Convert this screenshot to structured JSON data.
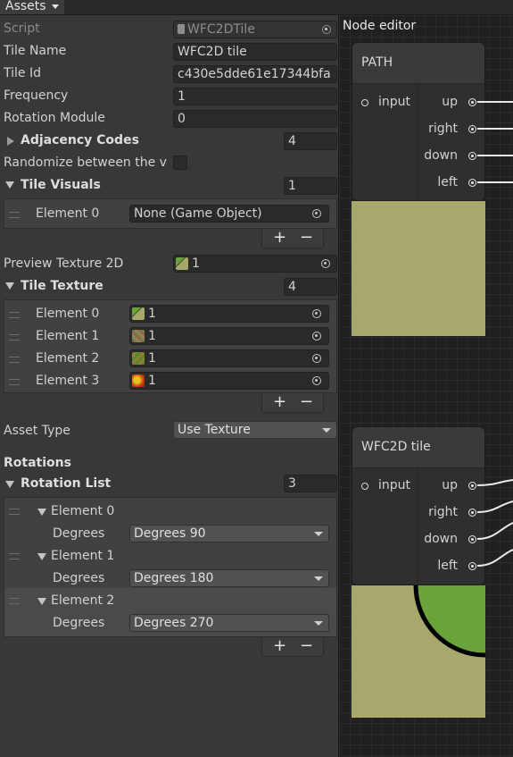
{
  "topbar": {
    "assets_label": "Assets"
  },
  "inspector": {
    "script": {
      "label": "Script",
      "value": "WFC2DTile"
    },
    "tile_name": {
      "label": "Tile Name",
      "value": "WFC2D tile"
    },
    "tile_id": {
      "label": "Tile Id",
      "value": "c430e5dde61e17344bfa"
    },
    "frequency": {
      "label": "Frequency",
      "value": "1"
    },
    "rotation_module": {
      "label": "Rotation Module",
      "value": "0"
    },
    "adjacency_codes": {
      "label": "Adjacency Codes",
      "count": "4"
    },
    "randomize": {
      "label": "Randomize between the v"
    },
    "tile_visuals": {
      "label": "Tile Visuals",
      "count": "1",
      "elements": [
        {
          "label": "Element 0",
          "value": "None (Game Object)"
        }
      ]
    },
    "preview_texture": {
      "label": "Preview Texture 2D",
      "value": "1"
    },
    "tile_texture": {
      "label": "Tile Texture",
      "count": "4",
      "elements": [
        {
          "label": "Element 0",
          "value": "1"
        },
        {
          "label": "Element 1",
          "value": "1"
        },
        {
          "label": "Element 2",
          "value": "1"
        },
        {
          "label": "Element 3",
          "value": "1"
        }
      ]
    },
    "asset_type": {
      "label": "Asset Type",
      "value": "Use Texture"
    },
    "rotations_header": "Rotations",
    "rotation_list": {
      "label": "Rotation List",
      "count": "3",
      "elements": [
        {
          "label": "Element 0",
          "field_label": "Degrees",
          "value": "Degrees 90"
        },
        {
          "label": "Element 1",
          "field_label": "Degrees",
          "value": "Degrees 180"
        },
        {
          "label": "Element 2",
          "field_label": "Degrees",
          "value": "Degrees 270"
        }
      ]
    },
    "add_symbol": "+",
    "remove_symbol": "−"
  },
  "node_editor": {
    "title": "Node editor",
    "nodes": [
      {
        "title": "PATH",
        "input": "input",
        "outputs": [
          "up",
          "right",
          "down",
          "left"
        ]
      },
      {
        "title": "WFC2D tile",
        "input": "input",
        "outputs": [
          "up",
          "right",
          "down",
          "left"
        ]
      }
    ]
  },
  "colors": {
    "tile_base": "#a6a86c",
    "grass": "#6aa33a",
    "outline": "#000000"
  }
}
